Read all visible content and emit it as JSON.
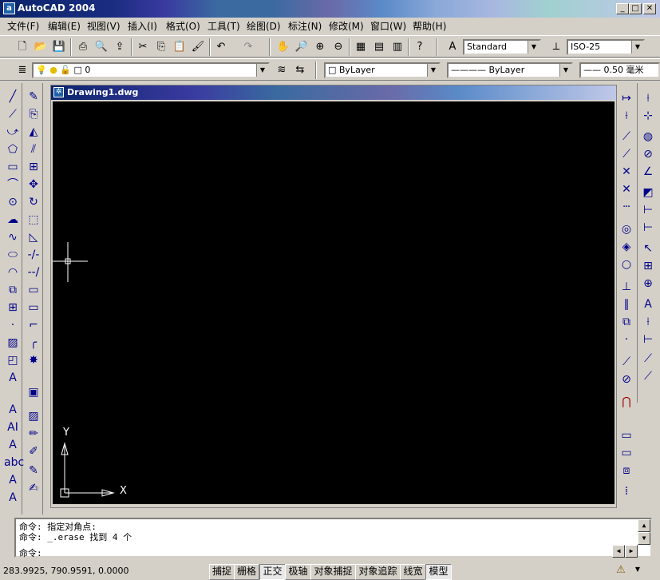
{
  "window": {
    "title": "AutoCAD 2004",
    "min": "_",
    "max": "□",
    "close": "✕"
  },
  "menu": [
    "文件(F)",
    "编辑(E)",
    "视图(V)",
    "插入(I)",
    "格式(O)",
    "工具(T)",
    "绘图(D)",
    "标注(N)",
    "修改(M)",
    "窗口(W)",
    "帮助(H)"
  ],
  "standard_toolbar": {
    "text_style": "Standard",
    "dim_style": "ISO-25"
  },
  "layers_toolbar": {
    "layer": "0",
    "color": "ByLayer",
    "linetype": "ByLayer",
    "lineweight": "0.50 毫米"
  },
  "document": {
    "title": "Drawing1.dwg"
  },
  "ucs": {
    "x_label": "X",
    "y_label": "Y"
  },
  "command": {
    "lines": [
      "命令: 指定对角点:",
      "命令: _.erase 找到 4 个"
    ],
    "prompt": "命令:"
  },
  "status": {
    "coords": "283.9925, 790.9591, 0.0000",
    "buttons": [
      "捕捉",
      "栅格",
      "正交",
      "极轴",
      "对象捕捉",
      "对象追踪",
      "线宽",
      "模型"
    ]
  },
  "colors": {
    "canvas": "#000000",
    "title_start": "#0a246a",
    "chrome": "#d4d0c8"
  },
  "icons": {
    "left_draw": [
      "line-icon",
      "construction-line-icon",
      "polyline-icon",
      "polygon-icon",
      "rectangle-icon",
      "arc-icon",
      "circle-icon",
      "revision-cloud-icon",
      "spline-icon",
      "ellipse-icon",
      "ellipse-arc-icon",
      "insert-block-icon",
      "make-block-icon",
      "point-icon",
      "hatch-icon",
      "region-icon",
      "multiline-text-icon"
    ],
    "left_modify": [
      "erase-icon",
      "copy-icon",
      "mirror-icon",
      "offset-icon",
      "array-icon",
      "move-icon",
      "rotate-icon",
      "scale-icon",
      "stretch-icon",
      "trim-icon",
      "extend-icon",
      "break-icon",
      "join-icon",
      "chamfer-icon",
      "fillet-icon",
      "explode-icon"
    ]
  }
}
